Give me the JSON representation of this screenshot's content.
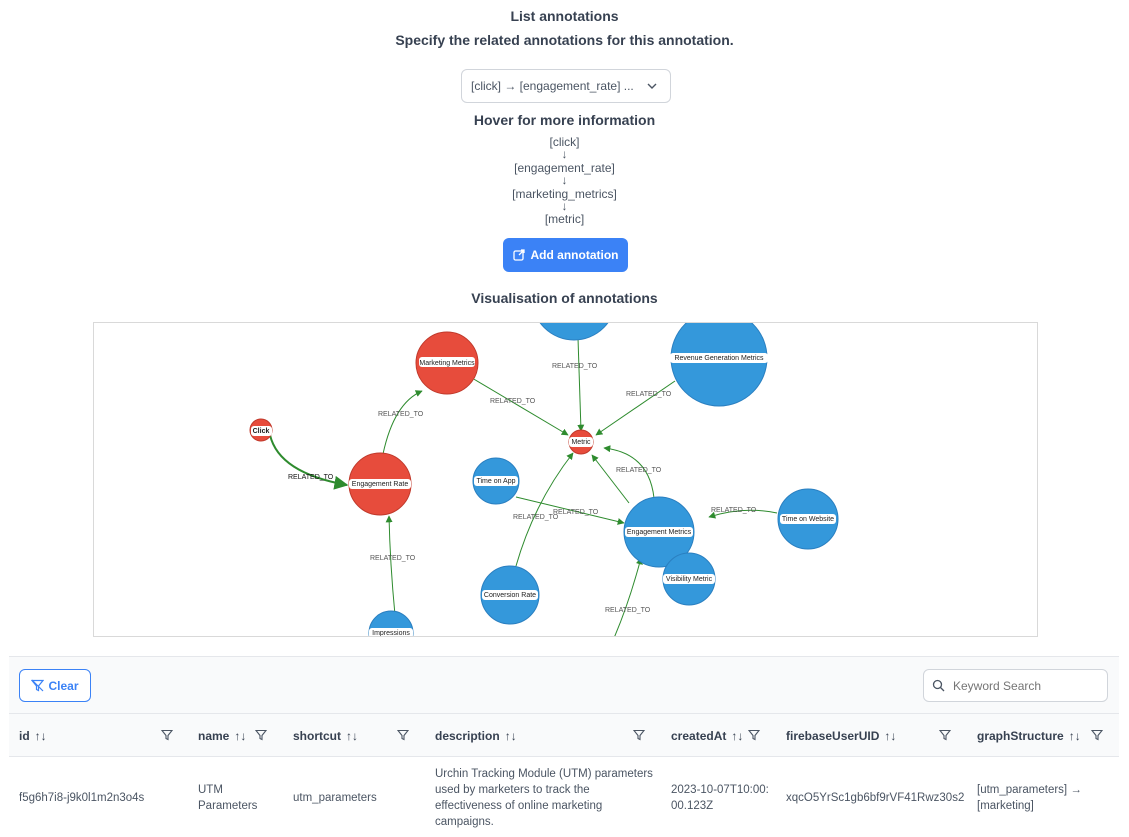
{
  "header": {
    "title": "List annotations",
    "subtitle": "Specify the related annotations for this annotation."
  },
  "select": {
    "value": "[click] → [engagement_rate] ..."
  },
  "hover": {
    "title": "Hover for more information",
    "chain": [
      "[click]",
      "[engagement_rate]",
      "[marketing_metrics]",
      "[metric]"
    ],
    "arrow": "↓"
  },
  "add_button": {
    "label": "Add annotation"
  },
  "visualisation": {
    "title": "Visualisation of annotations",
    "edge_label": "RELATED_TO",
    "nodes": {
      "marketing_metrics": "Marketing Metrics",
      "revenue": "Revenue Generation Metrics",
      "click": "Click",
      "metric": "Metric",
      "engagement_rate": "Engagement Rate",
      "time_on_app": "Time on App",
      "engagement_metrics": "Engagement Metrics",
      "time_on_website": "Time on Website",
      "visibility": "Visibility Metric",
      "conversion": "Conversion Rate",
      "impressions": "Impressions"
    },
    "colors": {
      "selected": "#e74c3c",
      "other": "#3498db",
      "edge": "#2e8b2e"
    }
  },
  "table": {
    "clear_label": "Clear",
    "search_placeholder": "Keyword Search",
    "columns": {
      "id": "id",
      "name": "name",
      "shortcut": "shortcut",
      "description": "description",
      "createdAt": "createdAt",
      "firebaseUserUID": "firebaseUserUID",
      "graphStructure": "graphStructure"
    },
    "sort_icon": "↑↓",
    "rows": [
      {
        "id": "f5g6h7i8-j9k0l1m2n3o4s",
        "name": "UTM Parameters",
        "shortcut": "utm_parameters",
        "description": "Urchin Tracking Module (UTM) parameters used by marketers to track the effectiveness of online marketing campaigns.",
        "createdAt": "2023-10-07T10:00:00.123Z",
        "firebaseUserUID": "xqcO5YrSc1gb6bf9rVF41Rwz30s2",
        "graphStructure": "[utm_parameters] → [marketing]"
      }
    ]
  }
}
